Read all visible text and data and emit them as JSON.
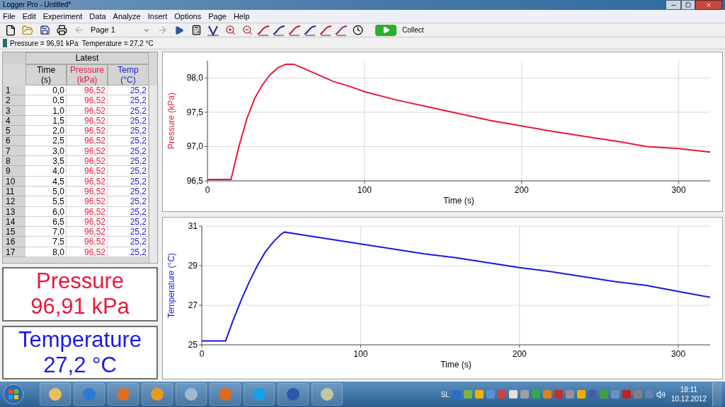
{
  "window": {
    "title": "Logger Pro - Untitled*"
  },
  "menu": [
    "File",
    "Edit",
    "Experiment",
    "Data",
    "Analyze",
    "Insert",
    "Options",
    "Page",
    "Help"
  ],
  "toolbar": {
    "page_selector": "Page 1",
    "collect_button": "Collect"
  },
  "status_line": "Pressure = 96,91 kPa  Temperature = 27,2 °C",
  "table": {
    "group_header": "Latest",
    "columns": [
      {
        "name": "Time",
        "unit": "(s)",
        "color": "#000000"
      },
      {
        "name": "Pressure",
        "unit": "(kPa)",
        "color": "#e8173c"
      },
      {
        "name": "Temp",
        "unit": "(°C)",
        "color": "#1a1ad8"
      }
    ],
    "rows": [
      {
        "n": "1",
        "cells": [
          "0,0",
          "96,52",
          "25,2"
        ]
      },
      {
        "n": "2",
        "cells": [
          "0,5",
          "96,52",
          "25,2"
        ]
      },
      {
        "n": "3",
        "cells": [
          "1,0",
          "96,52",
          "25,2"
        ]
      },
      {
        "n": "4",
        "cells": [
          "1,5",
          "96,52",
          "25,2"
        ]
      },
      {
        "n": "5",
        "cells": [
          "2,0",
          "96,52",
          "25,2"
        ]
      },
      {
        "n": "6",
        "cells": [
          "2,5",
          "96,52",
          "25,2"
        ]
      },
      {
        "n": "7",
        "cells": [
          "3,0",
          "96,52",
          "25,2"
        ]
      },
      {
        "n": "8",
        "cells": [
          "3,5",
          "96,52",
          "25,2"
        ]
      },
      {
        "n": "9",
        "cells": [
          "4,0",
          "96,52",
          "25,2"
        ]
      },
      {
        "n": "10",
        "cells": [
          "4,5",
          "96,52",
          "25,2"
        ]
      },
      {
        "n": "11",
        "cells": [
          "5,0",
          "96,52",
          "25,2"
        ]
      },
      {
        "n": "12",
        "cells": [
          "5,5",
          "96,52",
          "25,2"
        ]
      },
      {
        "n": "13",
        "cells": [
          "6,0",
          "96,52",
          "25,2"
        ]
      },
      {
        "n": "14",
        "cells": [
          "6,5",
          "96,52",
          "25,2"
        ]
      },
      {
        "n": "15",
        "cells": [
          "7,0",
          "96,52",
          "25,2"
        ]
      },
      {
        "n": "16",
        "cells": [
          "7,5",
          "96,52",
          "25,2"
        ]
      },
      {
        "n": "17",
        "cells": [
          "8,0",
          "96,52",
          "25,2"
        ]
      }
    ]
  },
  "meters": [
    {
      "label": "Pressure",
      "value": "96,91 kPa",
      "color": "#e8173c"
    },
    {
      "label": "Temperature",
      "value": "27,2 °C",
      "color": "#1a1ae6"
    }
  ],
  "graphs": [
    {
      "chart_data": {
        "type": "line",
        "xlabel": "Time (s)",
        "ylabel": "Pressure (kPa)",
        "xlim": [
          0,
          320
        ],
        "ylim": [
          96.5,
          98.25
        ],
        "xticks": [
          0,
          100,
          200,
          300
        ],
        "yticks": [
          {
            "value": 96.5,
            "label": "96,5"
          },
          {
            "value": 97,
            "label": "97,0"
          },
          {
            "value": 97.5,
            "label": "97,5"
          },
          {
            "value": 98,
            "label": "98,0"
          }
        ],
        "x": [
          0,
          10,
          15,
          20,
          25,
          30,
          35,
          40,
          45,
          50,
          55,
          60,
          70,
          80,
          90,
          100,
          120,
          140,
          160,
          180,
          200,
          220,
          240,
          260,
          280,
          300,
          320
        ],
        "grid": true,
        "series": [
          {
            "color": "#e8173c",
            "values": [
              96.52,
              96.52,
              96.52,
              97.0,
              97.4,
              97.7,
              97.9,
              98.05,
              98.15,
              98.2,
              98.2,
              98.15,
              98.05,
              97.95,
              97.88,
              97.8,
              97.68,
              97.58,
              97.48,
              97.38,
              97.3,
              97.22,
              97.15,
              97.08,
              97.0,
              96.97,
              96.92
            ]
          }
        ]
      }
    },
    {
      "chart_data": {
        "type": "line",
        "xlabel": "Time (s)",
        "ylabel": "Temperature (°C)",
        "xlim": [
          0,
          320
        ],
        "ylim": [
          25,
          31
        ],
        "xticks": [
          0,
          100,
          200,
          300
        ],
        "yticks": [
          25,
          27,
          29,
          31
        ],
        "x": [
          0,
          10,
          15,
          20,
          25,
          30,
          35,
          40,
          45,
          50,
          52,
          60,
          80,
          100,
          120,
          140,
          160,
          180,
          200,
          220,
          240,
          260,
          280,
          300,
          320
        ],
        "grid": true,
        "series": [
          {
            "color": "#1a1ad8",
            "values": [
              25.2,
              25.2,
              25.2,
              26.3,
              27.3,
              28.2,
              29.0,
              29.7,
              30.2,
              30.6,
              30.7,
              30.6,
              30.35,
              30.1,
              29.85,
              29.6,
              29.4,
              29.15,
              28.9,
              28.7,
              28.45,
              28.2,
              28.0,
              27.7,
              27.4
            ]
          }
        ]
      }
    }
  ],
  "taskbar": {
    "language": "SL",
    "time": "18:11",
    "date": "10.12.2012"
  }
}
